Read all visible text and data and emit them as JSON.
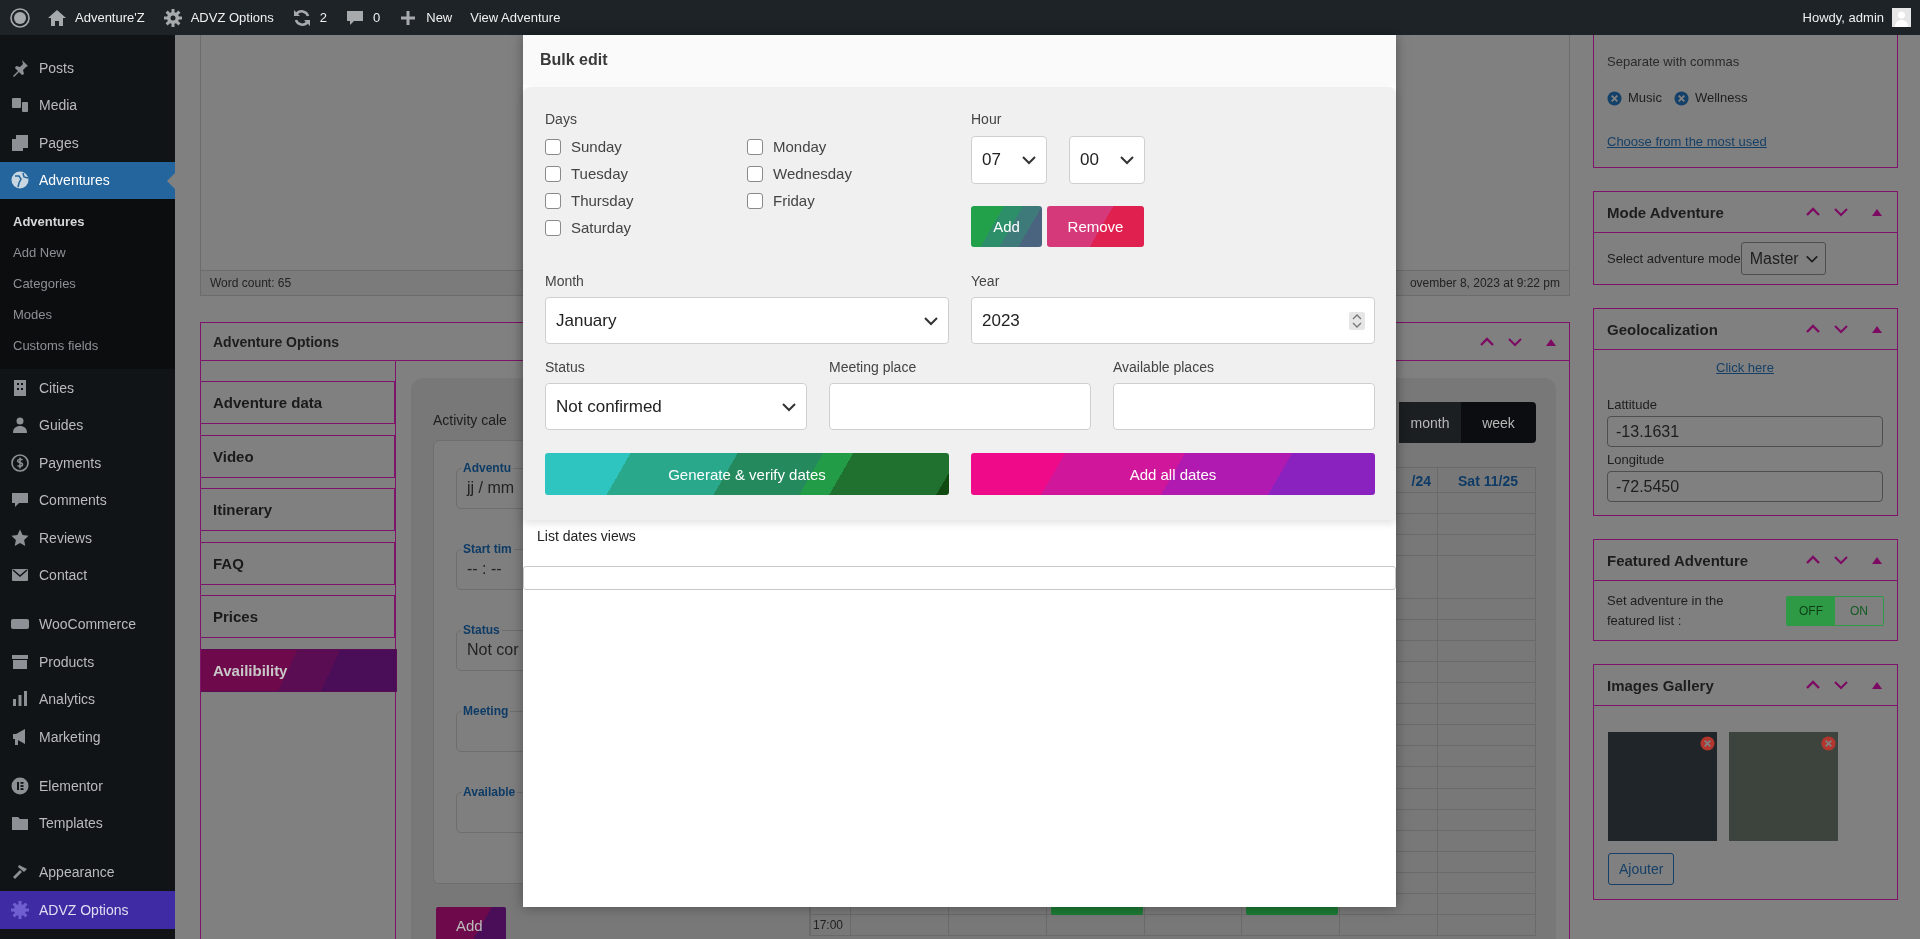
{
  "admin_bar": {
    "items": [
      "Adventure'Z",
      "ADVZ Options",
      "2",
      "0",
      "New",
      "View Adventure"
    ],
    "greeting": "Howdy, admin"
  },
  "admin_menu": {
    "groups": [
      {
        "items": [
          {
            "label": "Posts",
            "selected": false,
            "hovered": false
          },
          {
            "label": "Media",
            "selected": false,
            "hovered": false
          },
          {
            "label": "Pages",
            "selected": false,
            "hovered": false
          },
          {
            "label": "Adventures",
            "selected": true,
            "hovered": false,
            "submenu": [
              {
                "label": "Adventures",
                "selected": true
              },
              {
                "label": "Add New",
                "selected": false
              },
              {
                "label": "Categories",
                "selected": false
              },
              {
                "label": "Modes",
                "selected": false
              },
              {
                "label": "Customs fields",
                "selected": false
              }
            ]
          },
          {
            "label": "Cities",
            "selected": false,
            "hovered": false
          },
          {
            "label": "Guides",
            "selected": false,
            "hovered": false
          },
          {
            "label": "Payments",
            "selected": false,
            "hovered": false
          },
          {
            "label": "Comments",
            "selected": false,
            "hovered": false
          },
          {
            "label": "Reviews",
            "selected": false,
            "hovered": false
          },
          {
            "label": "Contact",
            "selected": false,
            "hovered": false
          }
        ]
      },
      {
        "items": [
          {
            "label": "WooCommerce",
            "selected": false,
            "hovered": false
          },
          {
            "label": "Products",
            "selected": false,
            "hovered": false
          },
          {
            "label": "Analytics",
            "selected": false,
            "hovered": false
          },
          {
            "label": "Marketing",
            "selected": false,
            "hovered": false
          }
        ]
      },
      {
        "items": [
          {
            "label": "Elementor",
            "selected": false,
            "hovered": false
          },
          {
            "label": "Templates",
            "selected": false,
            "hovered": false
          }
        ]
      },
      {
        "items": [
          {
            "label": "Appearance",
            "selected": false,
            "hovered": false
          },
          {
            "label": "ADVZ Options",
            "selected": false,
            "hovered": true
          }
        ]
      }
    ]
  },
  "editor": {
    "word_count": "Word count: 65",
    "last_edited": "ovember 8, 2023 at 9:22 pm"
  },
  "adventure_options": {
    "title": "Adventure Options",
    "tabs": [
      {
        "label": "Adventure data",
        "selected": false
      },
      {
        "label": "Video",
        "selected": false
      },
      {
        "label": "Itinerary",
        "selected": false
      },
      {
        "label": "FAQ",
        "selected": false
      },
      {
        "label": "Prices",
        "selected": false
      },
      {
        "label": "Availibility",
        "selected": true
      }
    ],
    "calendar_heading": "Activity cale",
    "fields": [
      {
        "legend": "Adventu",
        "value": "jj / mm"
      },
      {
        "legend": "Start tim",
        "value": "-- : --"
      },
      {
        "legend": "Status",
        "value": "Not cor"
      },
      {
        "legend": "Meeting"
      },
      {
        "legend": "Available"
      }
    ],
    "add_button": "Add",
    "calendar": {
      "views": [
        {
          "label": "month",
          "selected": false
        },
        {
          "label": "week",
          "selected": true
        }
      ],
      "day_headers": [
        "/24",
        "Sat 11/25"
      ],
      "time_label": "17:00"
    }
  },
  "tags_box": {
    "hint": "Separate with commas",
    "tags": [
      "Music",
      "Wellness"
    ],
    "link": "Choose from the most used"
  },
  "mode_box": {
    "title": "Mode Adventure",
    "label": "Select adventure mode",
    "value": "Master"
  },
  "geo_box": {
    "title": "Geolocalization",
    "link": "Click here",
    "latitude_label": "Lattitude",
    "latitude": "-13.1631",
    "longitude_label": "Longitude",
    "longitude": "-72.5450"
  },
  "featured_box": {
    "title": "Featured Adventure",
    "label": "Set adventure in the featured list :",
    "off_label": "OFF",
    "on_label": "ON",
    "on": false
  },
  "gallery_box": {
    "title": "Images Gallery",
    "button": "Ajouter"
  },
  "bulk_edit": {
    "title": "Bulk edit",
    "days_label": "Days",
    "days": [
      {
        "label": "Sunday",
        "checked": false
      },
      {
        "label": "Monday",
        "checked": false
      },
      {
        "label": "Tuesday",
        "checked": false
      },
      {
        "label": "Wednesday",
        "checked": false
      },
      {
        "label": "Thursday",
        "checked": false
      },
      {
        "label": "Friday",
        "checked": false
      },
      {
        "label": "Saturday",
        "checked": false
      }
    ],
    "hour_label": "Hour",
    "hour": "07",
    "minute": "00",
    "add": "Add",
    "remove": "Remove",
    "month_label": "Month",
    "month": "January",
    "year_label": "Year",
    "year": "2023",
    "status_label": "Status",
    "status": "Not confirmed",
    "meeting_label": "Meeting place",
    "places_label": "Available places",
    "generate": "Generate & verify dates",
    "add_all": "Add all dates",
    "list_label": "List dates views"
  }
}
